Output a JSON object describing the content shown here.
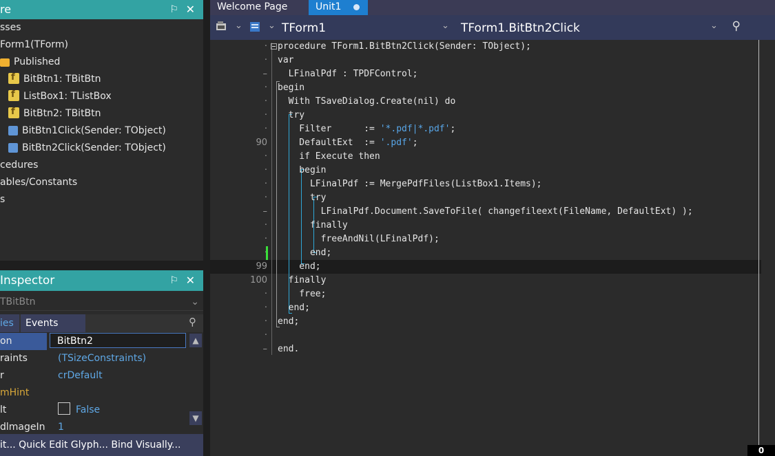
{
  "structure": {
    "title": "re",
    "pin": "⚐",
    "close": "✕",
    "items": [
      {
        "label": "sses",
        "icon": "none"
      },
      {
        "label": "Form1(TForm)",
        "icon": "none"
      },
      {
        "label": "Published",
        "icon": "folder-icon"
      },
      {
        "label": "BitBtn1: TBitBtn",
        "icon": "field-icon"
      },
      {
        "label": "ListBox1: TListBox",
        "icon": "field-icon"
      },
      {
        "label": "BitBtn2: TBitBtn",
        "icon": "field-icon"
      },
      {
        "label": "BitBtn1Click(Sender: TObject)",
        "icon": "method-icon"
      },
      {
        "label": "BitBtn2Click(Sender: TObject)",
        "icon": "method-icon"
      },
      {
        "label": "cedures",
        "icon": "none"
      },
      {
        "label": "ables/Constants",
        "icon": "none"
      },
      {
        "label": "s",
        "icon": "none"
      }
    ]
  },
  "inspector": {
    "title": "Inspector",
    "combo": "TBitBtn",
    "tab_properties": "ies",
    "tab_events": "Events",
    "rows": [
      {
        "name": "on",
        "value": "BitBtn2"
      },
      {
        "name": "raints",
        "value": "(TSizeConstraints)"
      },
      {
        "name": "r",
        "value": "crDefault"
      },
      {
        "name": "mHint",
        "value": ""
      },
      {
        "name": "lt",
        "value": "False"
      },
      {
        "name": "dlmageIn",
        "value": "1"
      }
    ],
    "bottom": "it... Quick Edit Glyph... Bind Visually..."
  },
  "tabs": {
    "welcome": "Welcome Page",
    "unit": "Unit1"
  },
  "toolbar": {
    "class_combo": "TForm1",
    "method_combo": "TForm1.BitBtn2Click"
  },
  "editor": {
    "gutter": [
      "·",
      "·",
      "–",
      "·",
      "·",
      "·",
      "·",
      "90",
      "·",
      "·",
      "·",
      "·",
      "–",
      "·",
      "·",
      "·",
      "99",
      "100",
      "·",
      "·",
      "·",
      "·",
      "–"
    ],
    "lines": [
      [
        {
          "t": "procedure TForm1.BitBtn2Click(Sender: TObject);",
          "c": ""
        }
      ],
      [
        {
          "t": "var",
          "c": ""
        }
      ],
      [
        {
          "t": "  LFinalPdf : TPDFControl;",
          "c": ""
        }
      ],
      [
        {
          "t": "begin",
          "c": ""
        }
      ],
      [
        {
          "t": "  With TSaveDialog.Create(nil) do",
          "c": ""
        }
      ],
      [
        {
          "t": "  try",
          "c": ""
        }
      ],
      [
        {
          "t": "    Filter      := ",
          "c": ""
        },
        {
          "t": "'*.pdf|*.pdf'",
          "c": "str"
        },
        {
          "t": ";",
          "c": ""
        }
      ],
      [
        {
          "t": "    DefaultExt  := ",
          "c": ""
        },
        {
          "t": "'.pdf'",
          "c": "str"
        },
        {
          "t": ";",
          "c": ""
        }
      ],
      [
        {
          "t": "    if Execute then",
          "c": ""
        }
      ],
      [
        {
          "t": "    begin",
          "c": ""
        }
      ],
      [
        {
          "t": "      LFinalPdf := MergePdfFiles(ListBox1.Items);",
          "c": ""
        }
      ],
      [
        {
          "t": "      try",
          "c": ""
        }
      ],
      [
        {
          "t": "        LFinalPdf.Document.SaveToFile( changefileext(FileName, DefaultExt) );",
          "c": ""
        }
      ],
      [
        {
          "t": "      finally",
          "c": ""
        }
      ],
      [
        {
          "t": "        freeAndNil(LFinalPdf);",
          "c": ""
        }
      ],
      [
        {
          "t": "      end;",
          "c": ""
        }
      ],
      [
        {
          "t": "    end;",
          "c": ""
        }
      ],
      [
        {
          "t": "  finally",
          "c": ""
        }
      ],
      [
        {
          "t": "    free;",
          "c": ""
        }
      ],
      [
        {
          "t": "  end;",
          "c": ""
        }
      ],
      [
        {
          "t": "end;",
          "c": ""
        }
      ],
      [
        {
          "t": "",
          "c": ""
        }
      ],
      [
        {
          "t": "end.",
          "c": ""
        }
      ]
    ]
  },
  "status": {
    "value": "0"
  },
  "colors": {
    "accent": "#33a3a3",
    "tab_active": "#1e7fd0",
    "string": "#58a6e8",
    "guide": "#2fa8d8"
  }
}
